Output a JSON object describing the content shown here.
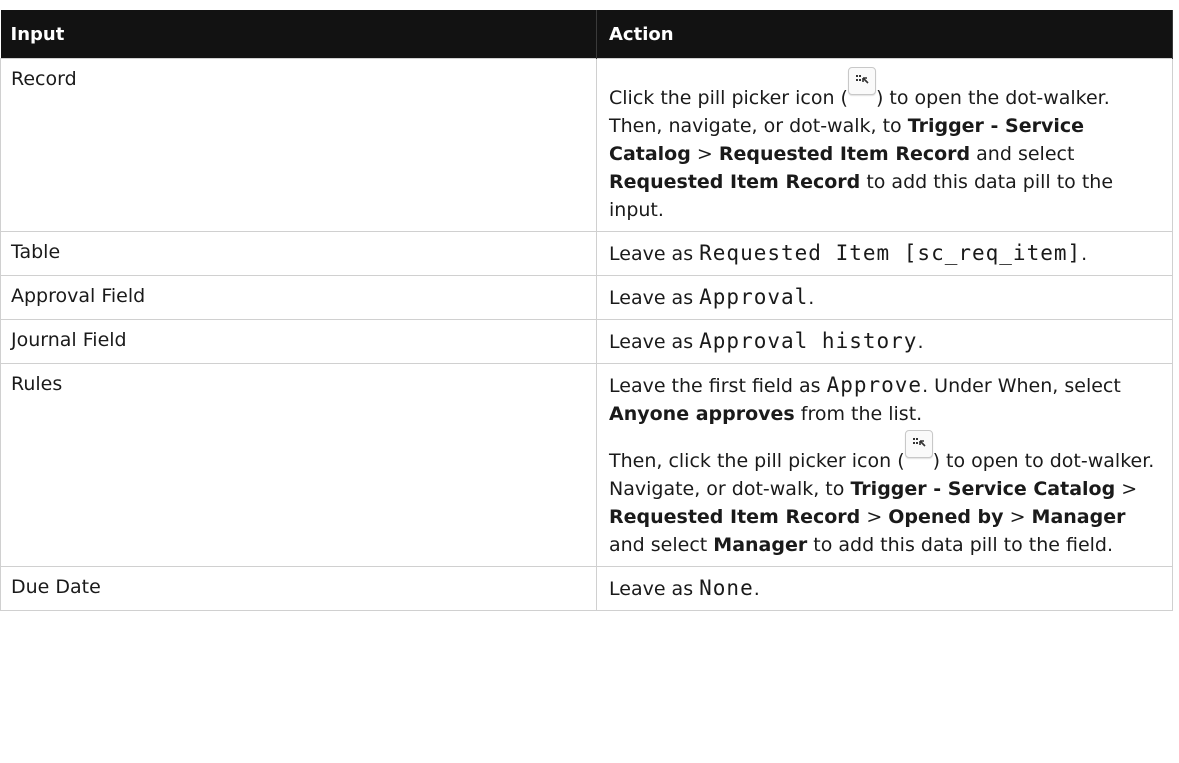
{
  "headers": {
    "input": "Input",
    "action": "Action"
  },
  "icons": {
    "pill_picker": "pill-picker-icon"
  },
  "rows": [
    {
      "input": "Record",
      "action": [
        {
          "t": "Click the pill picker icon ("
        },
        {
          "t": "",
          "icon": "pill-picker-icon"
        },
        {
          "t": ") to open the dot-walker. Then, navigate, or dot-walk, to "
        },
        {
          "t": "Trigger - Service Catalog",
          "b": true
        },
        {
          "t": " > "
        },
        {
          "t": "Requested Item Record",
          "b": true
        },
        {
          "t": " and select "
        },
        {
          "t": "Requested Item Record",
          "b": true
        },
        {
          "t": " to add this data pill to the input."
        }
      ]
    },
    {
      "input": "Table",
      "action": [
        {
          "t": "Leave as "
        },
        {
          "t": "Requested Item [sc_req_item]",
          "m": true
        },
        {
          "t": "."
        }
      ]
    },
    {
      "input": "Approval Field",
      "action": [
        {
          "t": "Leave as "
        },
        {
          "t": "Approval",
          "m": true
        },
        {
          "t": "."
        }
      ]
    },
    {
      "input": "Journal Field",
      "action": [
        {
          "t": "Leave as "
        },
        {
          "t": "Approval history",
          "m": true
        },
        {
          "t": "."
        }
      ]
    },
    {
      "input": "Rules",
      "action": [
        {
          "t": "Leave the first field as "
        },
        {
          "t": "Approve",
          "m": true
        },
        {
          "t": ". Under When, select "
        },
        {
          "t": "Anyone approves",
          "b": true
        },
        {
          "t": " from the list."
        }
      ],
      "action2": [
        {
          "t": "Then, click the pill picker icon ("
        },
        {
          "t": "",
          "icon": "pill-picker-icon"
        },
        {
          "t": ") to open to dot-walker. Navigate, or dot-walk, to "
        },
        {
          "t": "Trigger - Service Catalog",
          "b": true
        },
        {
          "t": " > "
        },
        {
          "t": "Requested Item Record",
          "b": true
        },
        {
          "t": " > "
        },
        {
          "t": "Opened by",
          "b": true
        },
        {
          "t": " > "
        },
        {
          "t": "Manager",
          "b": true
        },
        {
          "t": " and select "
        },
        {
          "t": "Manager",
          "b": true
        },
        {
          "t": " to add this data pill to the field."
        }
      ]
    },
    {
      "input": "Due Date",
      "action": [
        {
          "t": "Leave as "
        },
        {
          "t": "None",
          "m": true
        },
        {
          "t": "."
        }
      ]
    }
  ]
}
